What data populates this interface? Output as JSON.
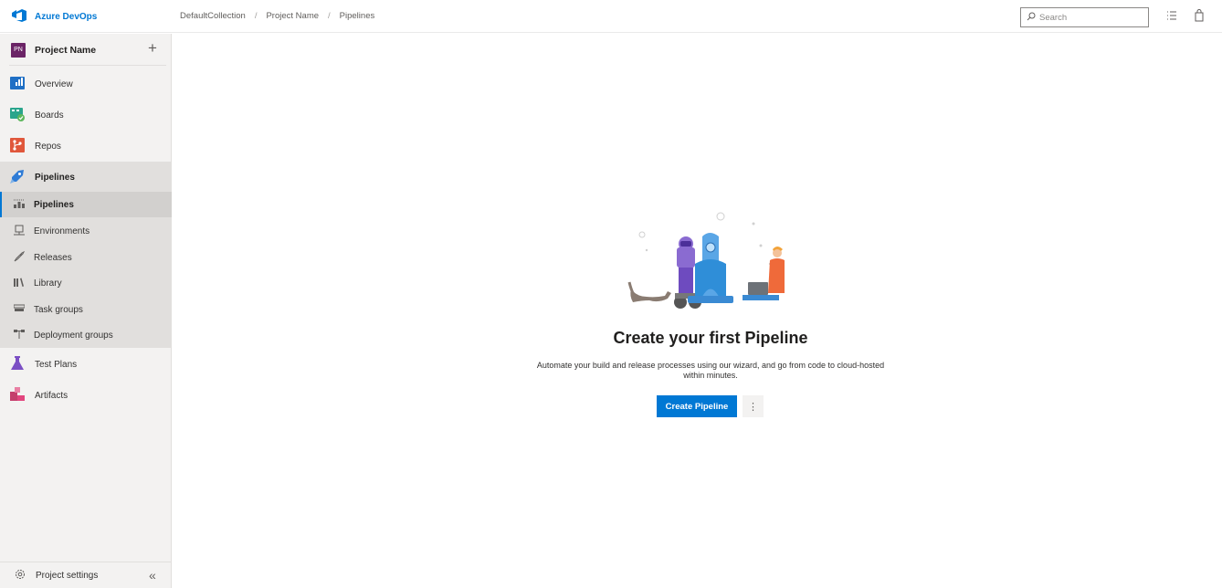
{
  "app": {
    "brand_label": "Azure DevOps",
    "accent": "#0078d4"
  },
  "breadcrumb": {
    "items": [
      "DefaultCollection",
      "Project Name",
      "Pipelines"
    ]
  },
  "search": {
    "placeholder": "Search"
  },
  "sidebar": {
    "project": {
      "badge": "PN",
      "name": "Project Name"
    },
    "items": [
      {
        "label": "Overview",
        "icon": "overview-icon"
      },
      {
        "label": "Boards",
        "icon": "boards-icon"
      },
      {
        "label": "Repos",
        "icon": "repos-icon"
      },
      {
        "label": "Pipelines",
        "icon": "pipelines-icon"
      },
      {
        "label": "Test Plans",
        "icon": "test-plans-icon"
      },
      {
        "label": "Artifacts",
        "icon": "artifacts-icon"
      }
    ],
    "sub_items": [
      {
        "label": "Pipelines",
        "icon": "pipelines-list-icon"
      },
      {
        "label": "Environments",
        "icon": "environments-icon"
      },
      {
        "label": "Releases",
        "icon": "releases-icon"
      },
      {
        "label": "Library",
        "icon": "library-icon"
      },
      {
        "label": "Task groups",
        "icon": "task-groups-icon"
      },
      {
        "label": "Deployment groups",
        "icon": "deployment-groups-icon"
      }
    ],
    "footer": {
      "label": "Project settings"
    }
  },
  "main": {
    "title": "Create your first Pipeline",
    "description": "Automate your build and release processes using our wizard, and go from code to cloud-hosted within minutes.",
    "create_button": "Create Pipeline",
    "more_button": "⋮"
  }
}
